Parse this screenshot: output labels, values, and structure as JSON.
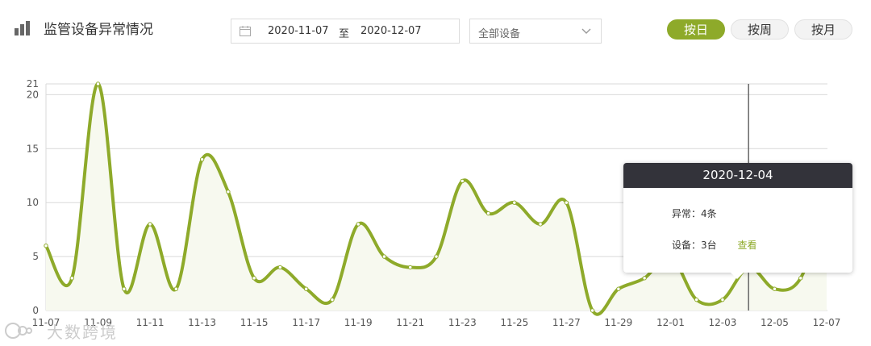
{
  "header": {
    "title": "监管设备异常情况",
    "icon": "bar-chart-icon"
  },
  "filters": {
    "start_date": "2020-11-07",
    "separator": "至",
    "end_date": "2020-12-07",
    "device_select": "全部设备"
  },
  "range_buttons": [
    {
      "label": "按日",
      "active": true
    },
    {
      "label": "按周",
      "active": false
    },
    {
      "label": "按月",
      "active": false
    }
  ],
  "tooltip": {
    "date": "2020-12-04",
    "anomaly_label": "异常：",
    "anomaly_value": "4条",
    "device_label": "设备：",
    "device_value": "3台",
    "link": "查看"
  },
  "watermark": "大数跨境",
  "colors": {
    "accent": "#8eaa2a",
    "tooltip_header": "#33333a",
    "grid": "#d9d9d9"
  },
  "chart_data": {
    "type": "line",
    "smooth": true,
    "area_fill": true,
    "x": [
      "11-07",
      "11-08",
      "11-09",
      "11-10",
      "11-11",
      "11-12",
      "11-13",
      "11-14",
      "11-15",
      "11-16",
      "11-17",
      "11-18",
      "11-19",
      "11-20",
      "11-21",
      "11-22",
      "11-23",
      "11-24",
      "11-25",
      "11-26",
      "11-27",
      "11-28",
      "11-29",
      "11-30",
      "12-01",
      "12-02",
      "12-03",
      "12-04",
      "12-05",
      "12-06",
      "12-07"
    ],
    "series": [
      {
        "values": [
          6,
          3,
          21,
          2,
          8,
          2,
          14,
          11,
          3,
          4,
          2,
          1,
          8,
          5,
          4,
          5,
          12,
          9,
          10,
          8,
          10,
          0,
          2,
          3,
          5,
          1,
          1,
          4,
          2,
          3,
          10
        ]
      }
    ],
    "x_tick_labels": [
      "11-07",
      "11-09",
      "11-11",
      "11-13",
      "11-15",
      "11-17",
      "11-19",
      "11-21",
      "11-23",
      "11-25",
      "11-27",
      "11-29",
      "12-01",
      "12-03",
      "12-05",
      "12-07"
    ],
    "y_ticks": [
      0,
      5,
      10,
      15,
      20,
      21
    ],
    "ylim": [
      0,
      21
    ],
    "grid": true,
    "highlight_x": "12-04"
  }
}
